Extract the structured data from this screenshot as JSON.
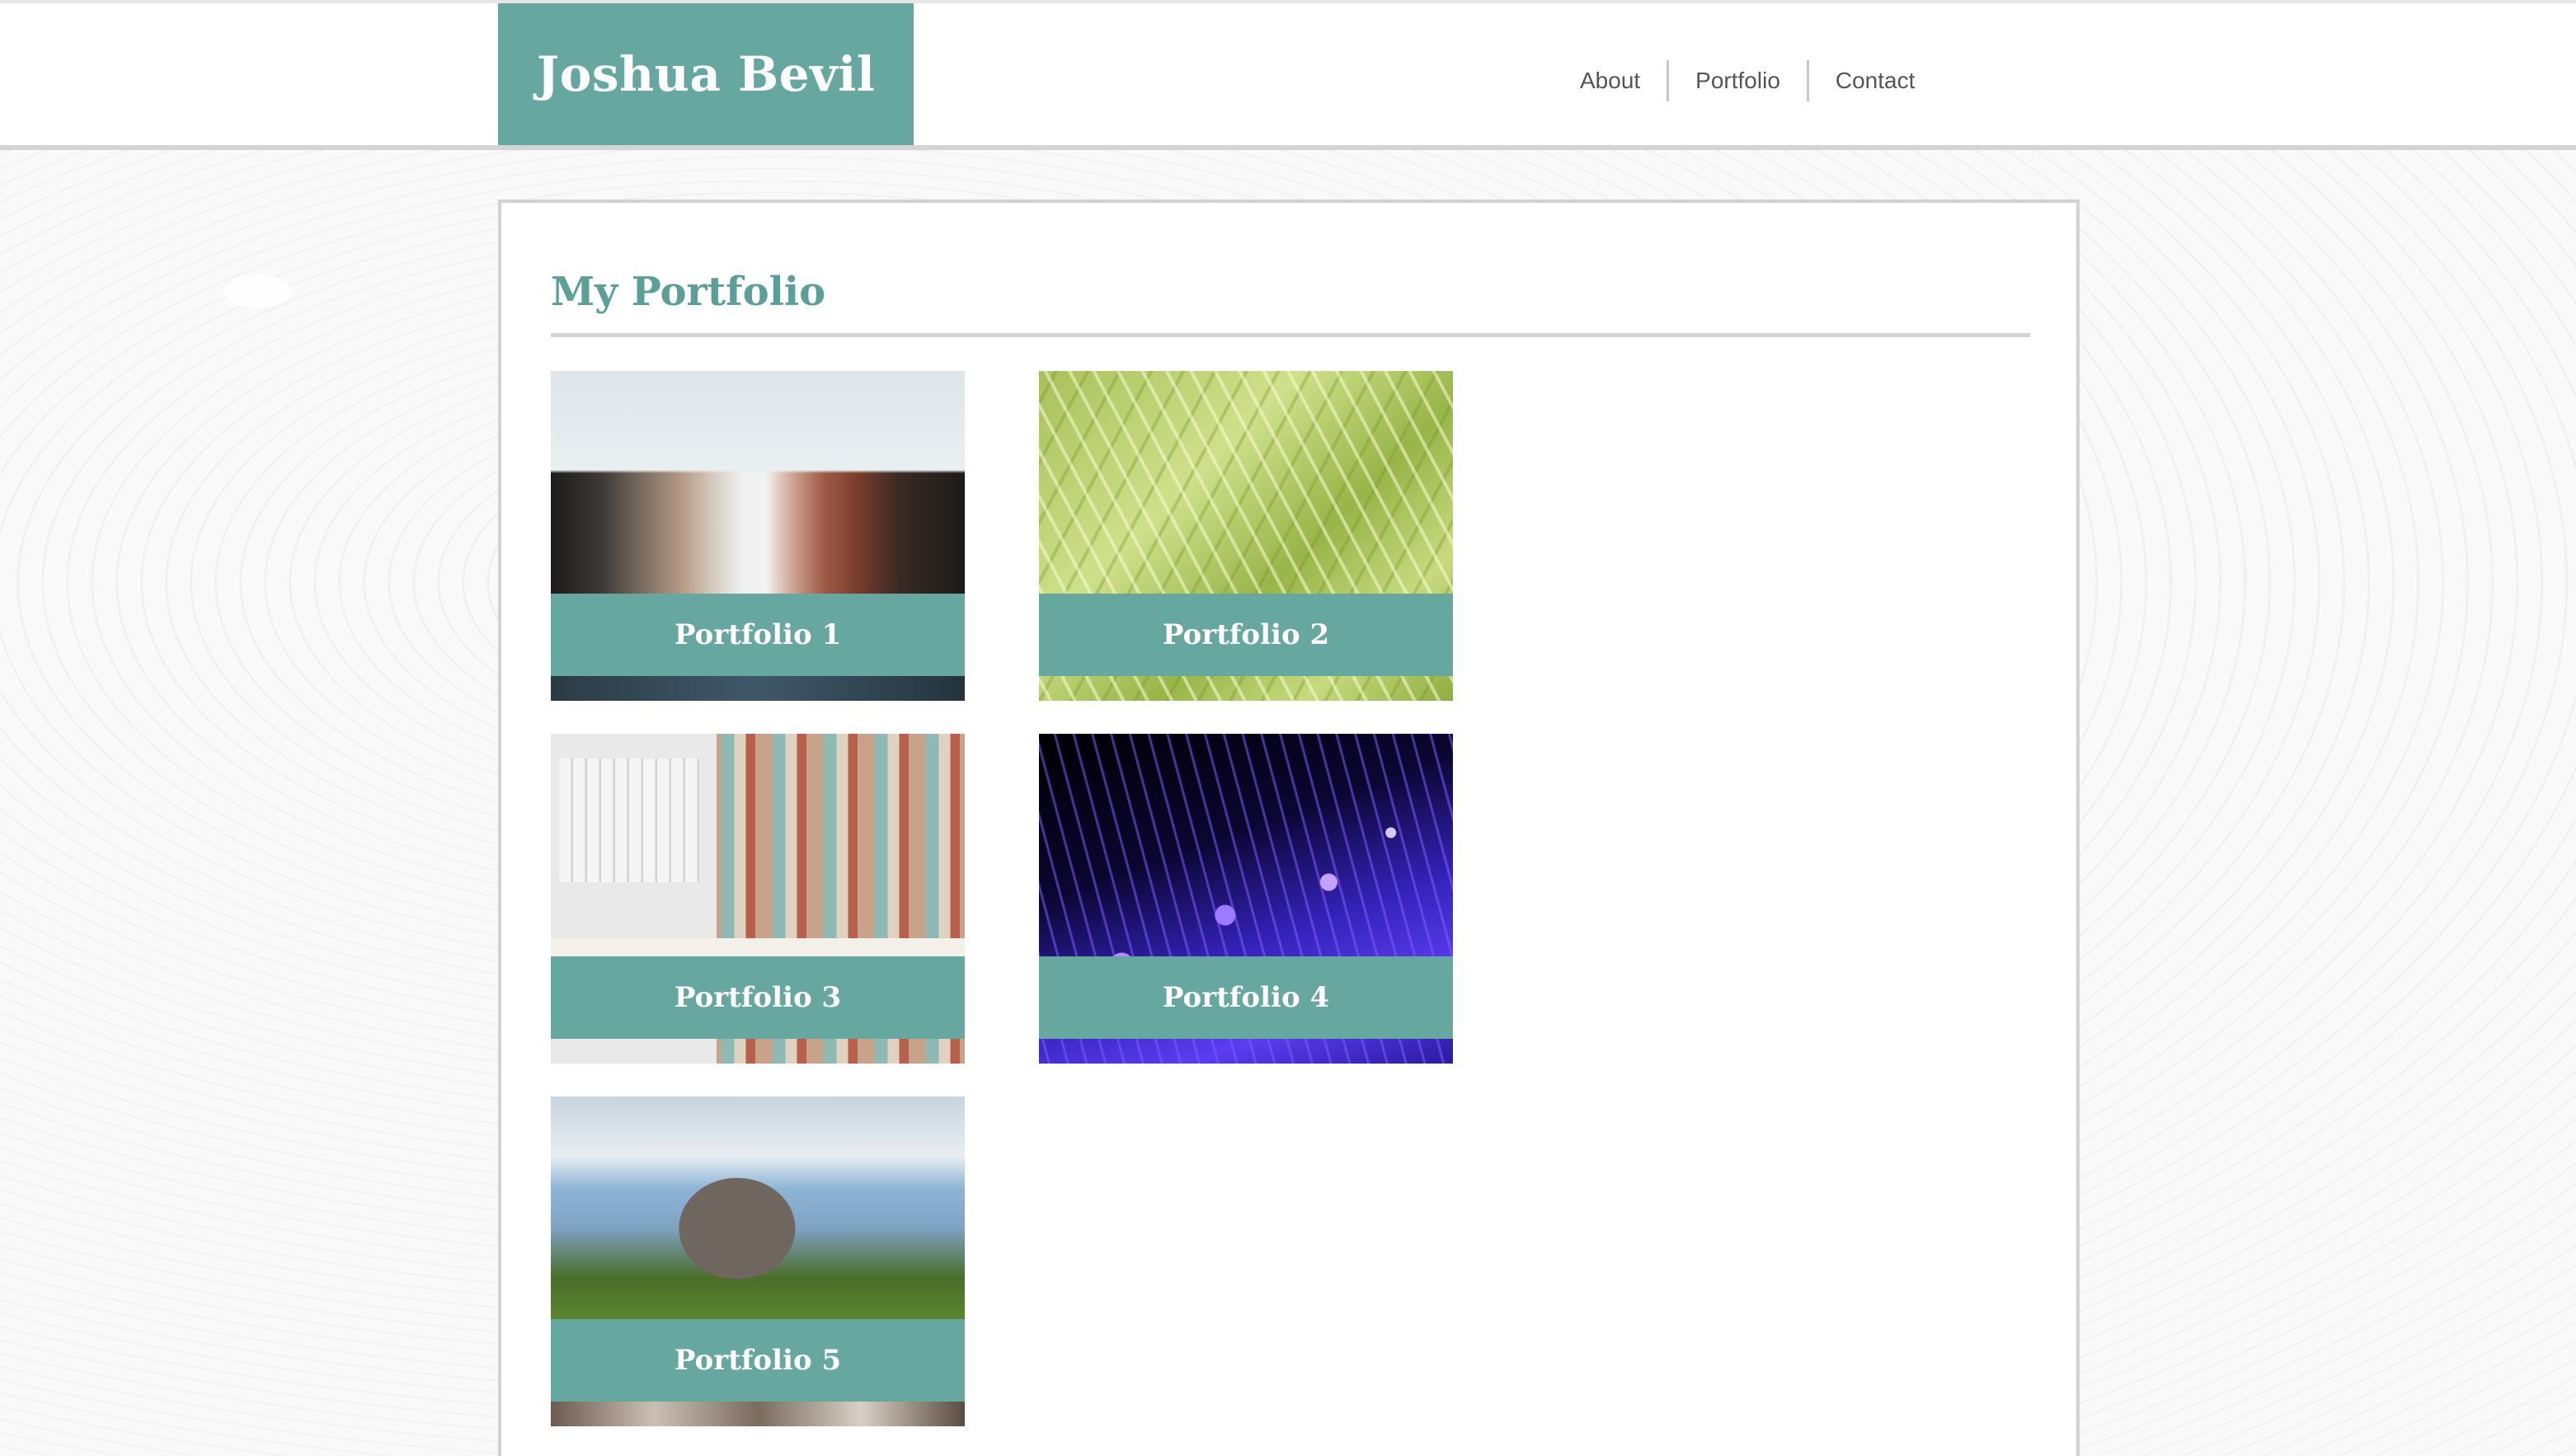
{
  "site": {
    "title": "Joshua Bevil"
  },
  "nav": {
    "items": [
      {
        "label": "About"
      },
      {
        "label": "Portfolio"
      },
      {
        "label": "Contact"
      }
    ]
  },
  "main": {
    "heading": "My Portfolio",
    "tiles": [
      {
        "label": "Portfolio 1"
      },
      {
        "label": "Portfolio 2"
      },
      {
        "label": "Portfolio 3"
      },
      {
        "label": "Portfolio 4"
      },
      {
        "label": "Portfolio 5"
      }
    ]
  },
  "colors": {
    "accent": "#66a8a0",
    "heading": "#5a9f98",
    "nav_text": "#555555"
  }
}
